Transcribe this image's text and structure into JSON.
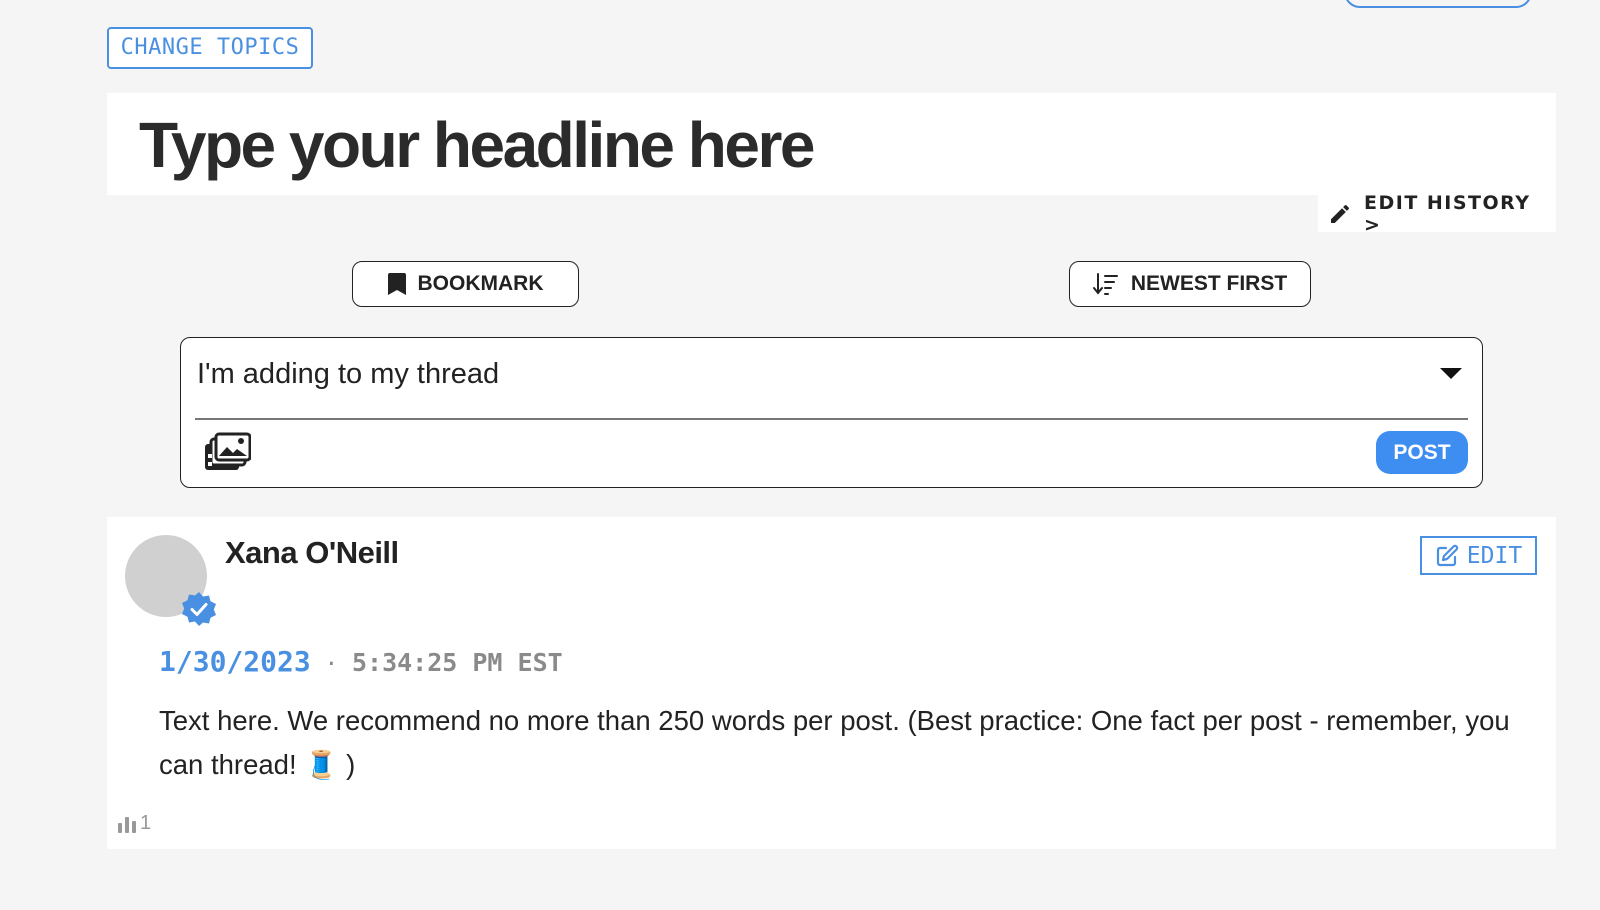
{
  "top_buttons": {
    "change_topics": "CHANGE TOPICS"
  },
  "headline": "Type your headline here",
  "edit_history": {
    "label": "EDIT HISTORY >",
    "icon": "pencil-icon"
  },
  "actions": {
    "bookmark": {
      "label": "BOOKMARK",
      "icon": "bookmark-icon"
    },
    "sort": {
      "label": "NEWEST FIRST",
      "icon": "sort-descending-icon"
    }
  },
  "composer": {
    "selected_option": "I'm adding to my thread",
    "media_icon": "media-gallery-icon",
    "post_label": "POST"
  },
  "post": {
    "author": "Xana O'Neill",
    "verified": true,
    "edit_label": "EDIT",
    "date": "1/30/2023",
    "separator": "·",
    "time": "5:34:25 PM EST",
    "body": "Text here. We recommend no more than 250 words per post. (Best practice: One fact per post - remember, you can thread! 🧵 )",
    "views": "1"
  },
  "colors": {
    "accent": "#4a90e2",
    "post_button": "#3d8ef0",
    "background": "#f5f5f5",
    "text": "#222222"
  }
}
